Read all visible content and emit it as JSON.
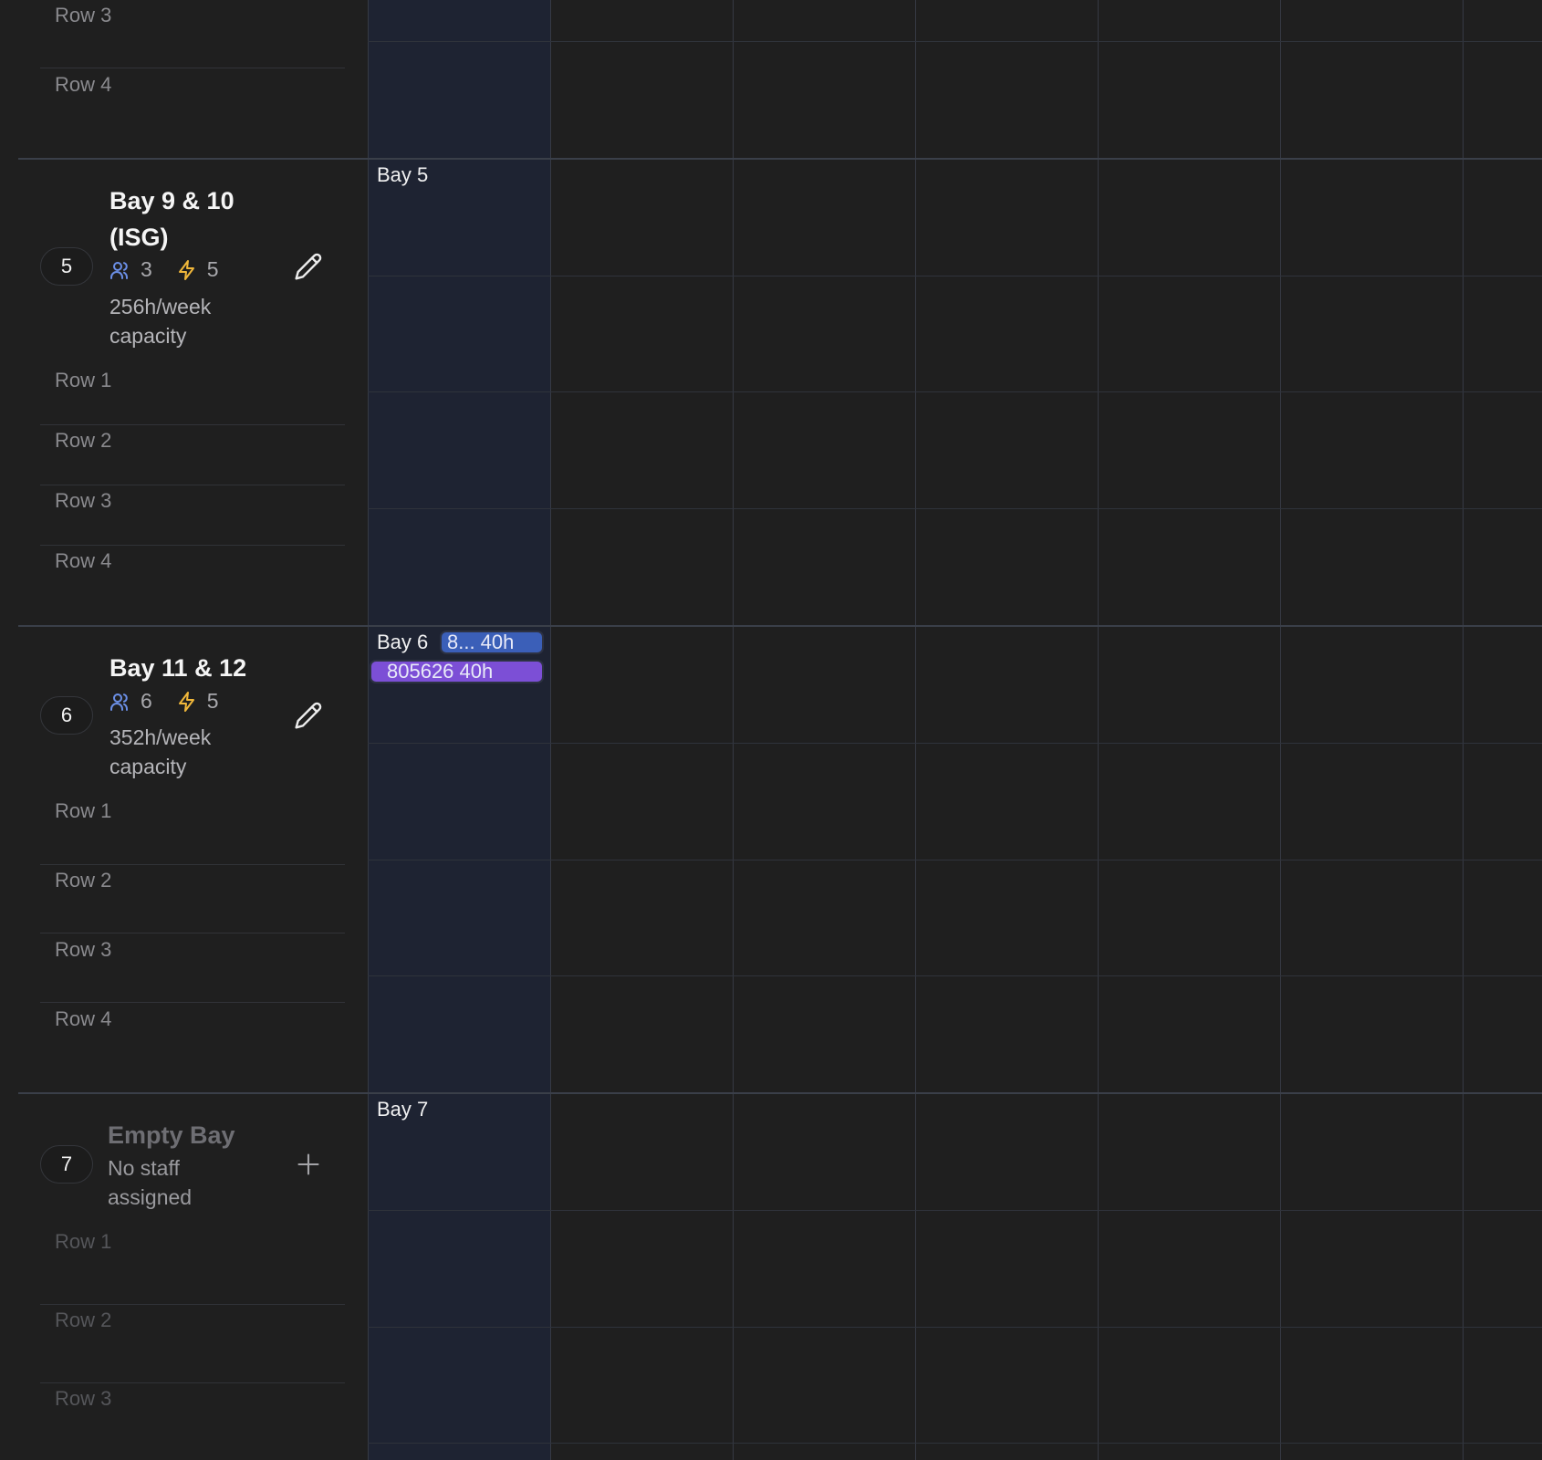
{
  "top_rows": [
    "Row 3",
    "Row 4"
  ],
  "bays": [
    {
      "number": "5",
      "title_line1": "Bay 9 & 10",
      "title_line2": "(ISG)",
      "staff_count": "3",
      "power_count": "5",
      "capacity_line1": "256h/week",
      "capacity_line2": "capacity",
      "rows": [
        "Row 1",
        "Row 2",
        "Row 3",
        "Row 4"
      ],
      "grid_label": "Bay 5"
    },
    {
      "number": "6",
      "title_line1": "Bay 11 & 12",
      "staff_count": "6",
      "power_count": "5",
      "capacity_line1": "352h/week",
      "capacity_line2": "capacity",
      "rows": [
        "Row 1",
        "Row 2",
        "Row 3",
        "Row 4"
      ],
      "grid_label": "Bay 6",
      "jobs": [
        {
          "label": "8... 40h",
          "color": "#3b5fb8"
        },
        {
          "label": "805626  40h",
          "color": "#7c4fd6"
        }
      ]
    },
    {
      "number": "7",
      "title_line1": "Empty Bay",
      "subtitle_line1": "No staff",
      "subtitle_line2": "assigned",
      "rows": [
        "Row 1",
        "Row 2",
        "Row 3"
      ],
      "grid_label": "Bay 7"
    }
  ],
  "icons": {
    "staff": "users-icon",
    "power": "lightning-icon",
    "edit": "pencil-icon",
    "add": "plus-icon"
  },
  "colors": {
    "background": "#1f1f1f",
    "current_week_column": "#1e2332",
    "staff_icon": "#6b8fe6",
    "power_icon": "#f0b73a"
  }
}
